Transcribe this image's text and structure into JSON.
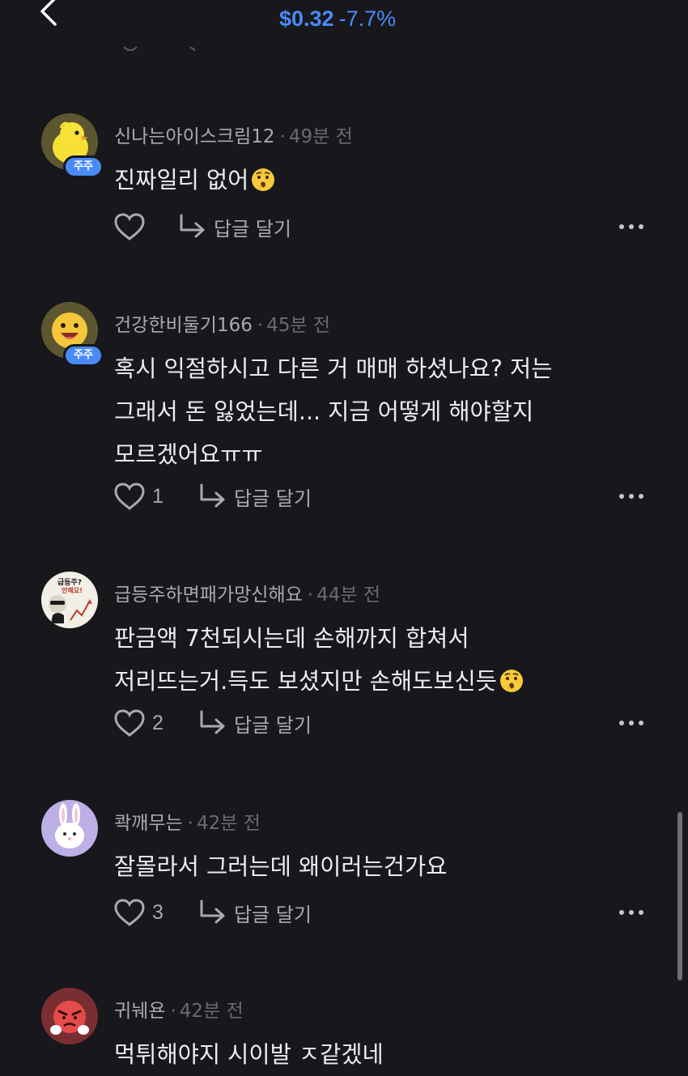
{
  "header": {
    "price": "$0.32",
    "change": "-7.7%"
  },
  "comments": [
    {
      "name": "신나는아이스크림12",
      "time": "49분 전",
      "badge": "주주",
      "lines": [
        "진짜일리 없어"
      ],
      "emoji": "thinking-face",
      "likes": "",
      "reply_label": "답글 달기"
    },
    {
      "name": "건강한비둘기166",
      "time": "45분 전",
      "badge": "주주",
      "lines": [
        "혹시 익절하시고 다른 거 매매 하셨나요? 저는",
        "그래서 돈 잃었는데... 지금 어떻게 해야할지",
        "모르겠어요ㅠㅠ"
      ],
      "likes": "1",
      "reply_label": "답글 달기"
    },
    {
      "name": "급등주하면패가망신해요",
      "time": "44분 전",
      "lines": [
        "판금액 7천되시는데 손해까지 합쳐서",
        "저리뜨는거.득도 보셨지만 손해도보신듯"
      ],
      "emoji": "thinking-face",
      "likes": "2",
      "reply_label": "답글 달기",
      "avatar_text": [
        "급등주?",
        "안해요!"
      ]
    },
    {
      "name": "콱깨무는",
      "time": "42분 전",
      "lines": [
        "잘몰라서 그러는데 왜이러는건가요"
      ],
      "likes": "3",
      "reply_label": "답글 달기"
    },
    {
      "name": "귀눼욘",
      "time": "42분 전",
      "lines": [
        "먹튀해야지 시이발 ㅈ같겠네"
      ],
      "likes": "",
      "reply_label": "답글 달기"
    }
  ],
  "colors": {
    "background": "#17171c",
    "accent": "#4a8af6",
    "name_text": "#a9a9b0",
    "time_text": "#6a6a72",
    "body_text": "#ededf0"
  },
  "icons": {
    "back": "chevron-left-icon",
    "like": "heart-outline-icon",
    "reply": "reply-arrow-icon",
    "more": "more-horizontal-icon"
  }
}
